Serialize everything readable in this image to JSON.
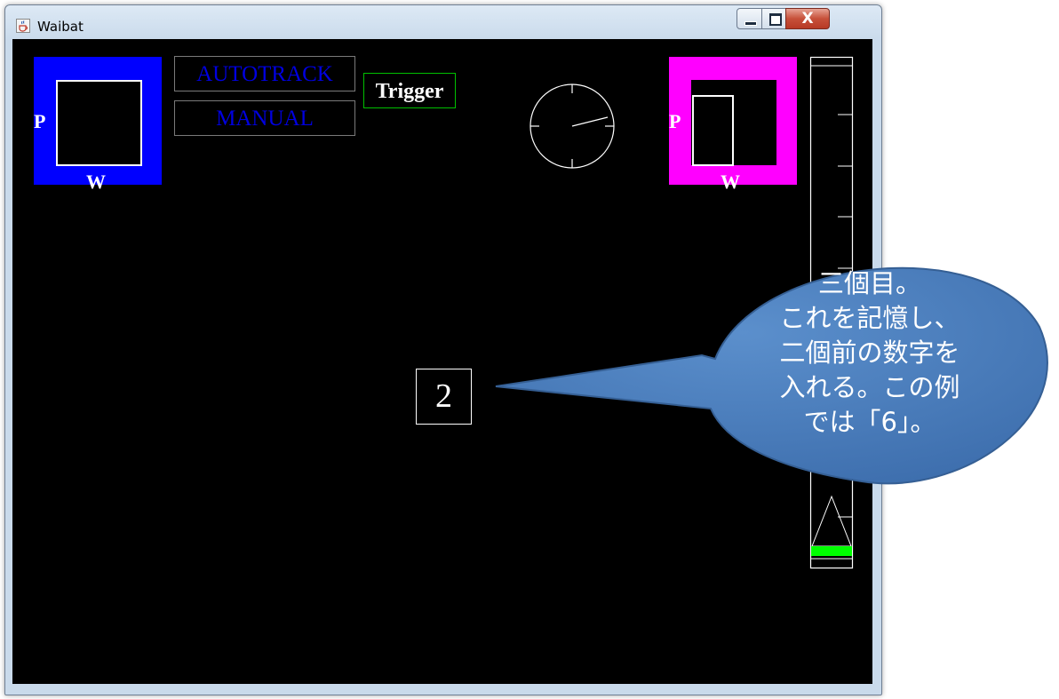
{
  "window": {
    "title": "Waibat",
    "close_symbol": "X",
    "icons": {
      "app": "java-cup-icon",
      "minimize": "minimize-icon",
      "maximize": "maximize-icon",
      "close": "close-icon"
    }
  },
  "left_indicator": {
    "p_label": "P",
    "w_label": "W",
    "color": "#0000ff"
  },
  "right_indicator": {
    "p_label": "P",
    "w_label": "W",
    "color": "#ff00ff"
  },
  "mode_buttons": {
    "autotrack": "AUTOTRACK",
    "manual": "MANUAL",
    "text_color": "#0000e0"
  },
  "trigger": {
    "label": "Trigger",
    "border_color": "#00c000"
  },
  "stimulus": {
    "number": "2"
  },
  "gauge": {
    "fill_color": "#00ff00"
  },
  "callout": {
    "lines": [
      "三個目。",
      "これを記憶し、",
      "二個前の数字を",
      "入れる。この例",
      "では「6」。"
    ],
    "fill_color": "#4f81bd"
  }
}
